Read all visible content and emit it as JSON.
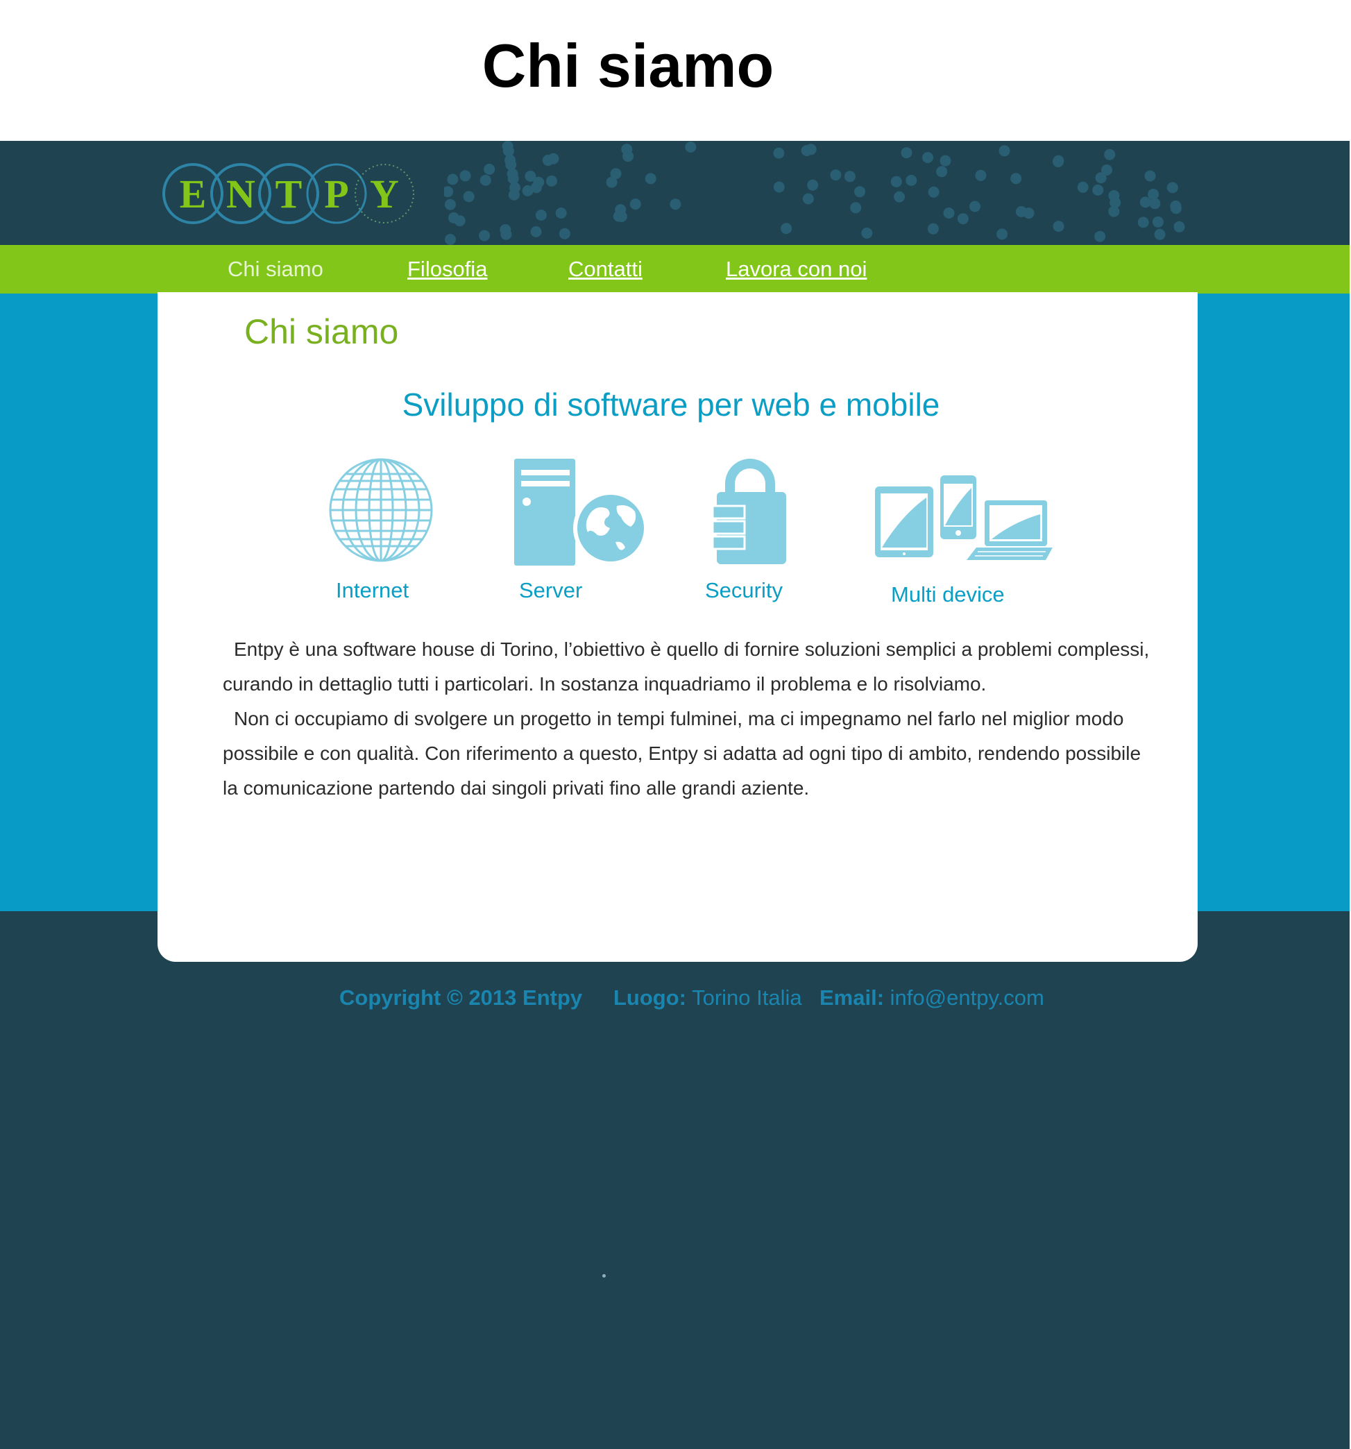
{
  "page": {
    "heading": "Chi siamo"
  },
  "brand": {
    "logo_letters": [
      "E",
      "N",
      "T",
      "P",
      "Y"
    ]
  },
  "nav": {
    "items": [
      {
        "label": "Chi siamo",
        "active": true
      },
      {
        "label": "Filosofia",
        "active": false
      },
      {
        "label": "Contatti",
        "active": false
      },
      {
        "label": "Lavora con noi",
        "active": false
      }
    ]
  },
  "content": {
    "title": "Chi siamo",
    "subtitle": "Sviluppo di software per web e mobile",
    "features": [
      {
        "label": "Internet",
        "icon": "globe-icon"
      },
      {
        "label": "Server",
        "icon": "server-icon"
      },
      {
        "label": "Security",
        "icon": "padlock-icon"
      },
      {
        "label": "Multi device",
        "icon": "devices-icon"
      }
    ],
    "paragraphs": [
      "Entpy è una software house di Torino,  l’obiettivo è quello di fornire soluzioni semplici a problemi complessi, curando in dettaglio tutti i particolari. In sostanza inquadriamo il problema e lo risolviamo.",
      "Non ci occupiamo di svolgere un progetto in tempi fulminei, ma ci impegnamo nel farlo nel miglior modo possibile e con qualità. Con riferimento a questo, Entpy si adatta ad ogni tipo di ambito, rendendo possibile la comunicazione partendo dai singoli privati fino alle grandi aziente."
    ]
  },
  "footer": {
    "copyright": "Copyright © 2013  Entpy",
    "place_label": "Luogo:",
    "place_value": "Torino Italia",
    "email_label": "Email:",
    "email_value": "info@entpy.com"
  },
  "colors": {
    "dark_teal": "#1f4351",
    "green": "#82c61a",
    "blue": "#089bc6",
    "icon_blue": "#86cfe2",
    "title_green": "#78b020"
  }
}
